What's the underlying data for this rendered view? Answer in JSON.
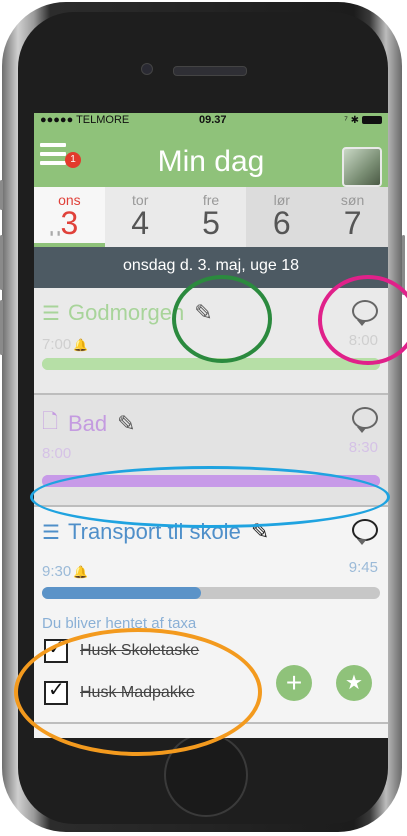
{
  "status": {
    "carrier": "●●●●● TELMORE",
    "time": "09.37",
    "right": "⁷ ✱"
  },
  "header": {
    "title": "Min dag",
    "badge": "1"
  },
  "days": [
    {
      "name": "ons",
      "num": "3"
    },
    {
      "name": "tor",
      "num": "4"
    },
    {
      "name": "fre",
      "num": "5"
    },
    {
      "name": "lør",
      "num": "6"
    },
    {
      "name": "søn",
      "num": "7"
    }
  ],
  "date_label": "onsdag d. 3. maj, uge 18",
  "events": [
    {
      "title": "Godmorgen",
      "start": "7:00",
      "end": "8:00",
      "color": "#a8d49a",
      "bar_bg": "#b6dfa6",
      "progress": 1.0
    },
    {
      "title": "Bad",
      "start": "8:00",
      "end": "8:30",
      "color": "#c49be0",
      "bar_bg": "#c79ae8",
      "progress": 1.0
    },
    {
      "title": "Transport til skole",
      "start": "9:30",
      "end": "9:45",
      "color": "#4f8fc9",
      "bar_bg": "#c7c7c7",
      "progress": 0.47
    }
  ],
  "note": "Du bliver hentet af taxa",
  "todos": [
    "Husk Skoletaske",
    "Husk Madpakke"
  ],
  "fab": {
    "add": "+",
    "star": "★"
  },
  "icons": {
    "list": "☰",
    "doc": "🗋",
    "pen": "✎",
    "bell": "🔔"
  }
}
